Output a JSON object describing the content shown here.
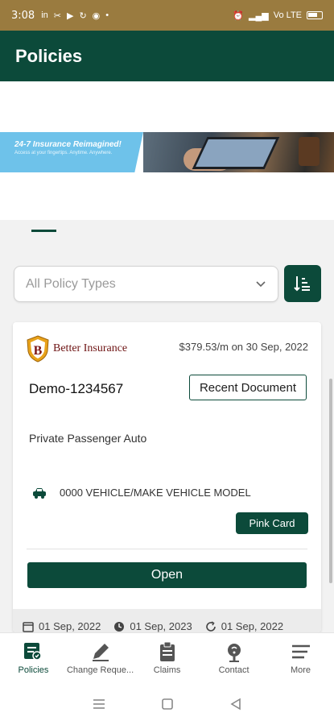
{
  "status_bar": {
    "time": "3:08",
    "icons": [
      "linkedin-icon",
      "dialpad-icon",
      "youtube-icon",
      "sync-icon",
      "chrome-icon",
      "dot-icon"
    ],
    "right_icons": [
      "alarm-icon",
      "signal-icon",
      "wifi-icon",
      "battery-icon"
    ],
    "network": "Vo LTE"
  },
  "app_bar": {
    "title": "Policies"
  },
  "banner": {
    "headline": "24-7 Insurance Reimagined!",
    "subline": "Access at your fingertips. Anytime. Anywhere."
  },
  "filter": {
    "selected": "All Policy Types"
  },
  "card": {
    "brand_letter": "B",
    "brand_name": "Better Insurance",
    "premium": "$379.53/m on 30 Sep, 2022",
    "policy_number": "Demo-1234567",
    "recent_document_label": "Recent Document",
    "policy_type": "Private Passenger Auto",
    "vehicle": "0000 VEHICLE/MAKE VEHICLE MODEL",
    "pink_card_label": "Pink Card",
    "open_label": "Open",
    "dates": [
      "01 Sep, 2022",
      "01 Sep, 2023",
      "01 Sep, 2022"
    ]
  },
  "bottom_nav": [
    {
      "label": "Policies",
      "icon": "policies-icon",
      "active": true
    },
    {
      "label": "Change Reque...",
      "icon": "pencil-icon",
      "active": false
    },
    {
      "label": "Claims",
      "icon": "clipboard-icon",
      "active": false
    },
    {
      "label": "Contact",
      "icon": "headset-icon",
      "active": false
    },
    {
      "label": "More",
      "icon": "menu-icon",
      "active": false
    }
  ],
  "colors": {
    "primary": "#0c4a3a",
    "status_bar": "#9a7b3f",
    "banner_blue": "#6ec2ea",
    "brand_red": "#6e1414"
  }
}
